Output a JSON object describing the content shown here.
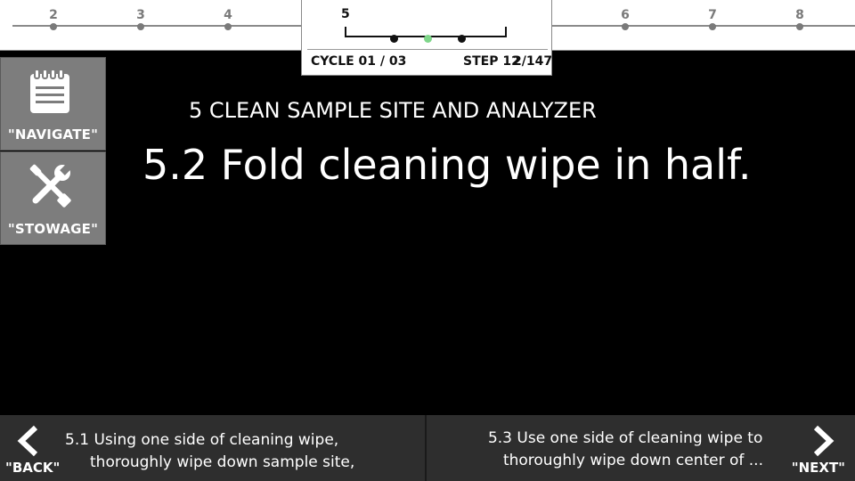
{
  "timeline": {
    "sections": [
      {
        "num": "2"
      },
      {
        "num": "3"
      },
      {
        "num": "4"
      },
      {
        "num": "6"
      },
      {
        "num": "7"
      },
      {
        "num": "8"
      }
    ],
    "current_section": "5",
    "cycle": "CYCLE 01 / 03",
    "step": "STEP 12",
    "step_overlap": "2/147",
    "active_step_color": "#7fd68a"
  },
  "tools": {
    "navigate_label": "\"NAVIGATE\"",
    "stowage_label": "\"STOWAGE\"",
    "navigate_icon": "clipboard-icon",
    "stowage_icon": "wrench-screwdriver-icon"
  },
  "main": {
    "section_title": "5  CLEAN SAMPLE SITE AND ANALYZER",
    "step_text": "5.2  Fold cleaning wipe in half."
  },
  "nav": {
    "back_label": "\"BACK\"",
    "back_line1": "5.1  Using one side of cleaning wipe,",
    "back_line2": "thoroughly wipe down sample site,",
    "next_label": "\"NEXT\"",
    "next_line1": "5.3  Use one side of cleaning wipe to",
    "next_line2": "thoroughly wipe down center of ..."
  }
}
